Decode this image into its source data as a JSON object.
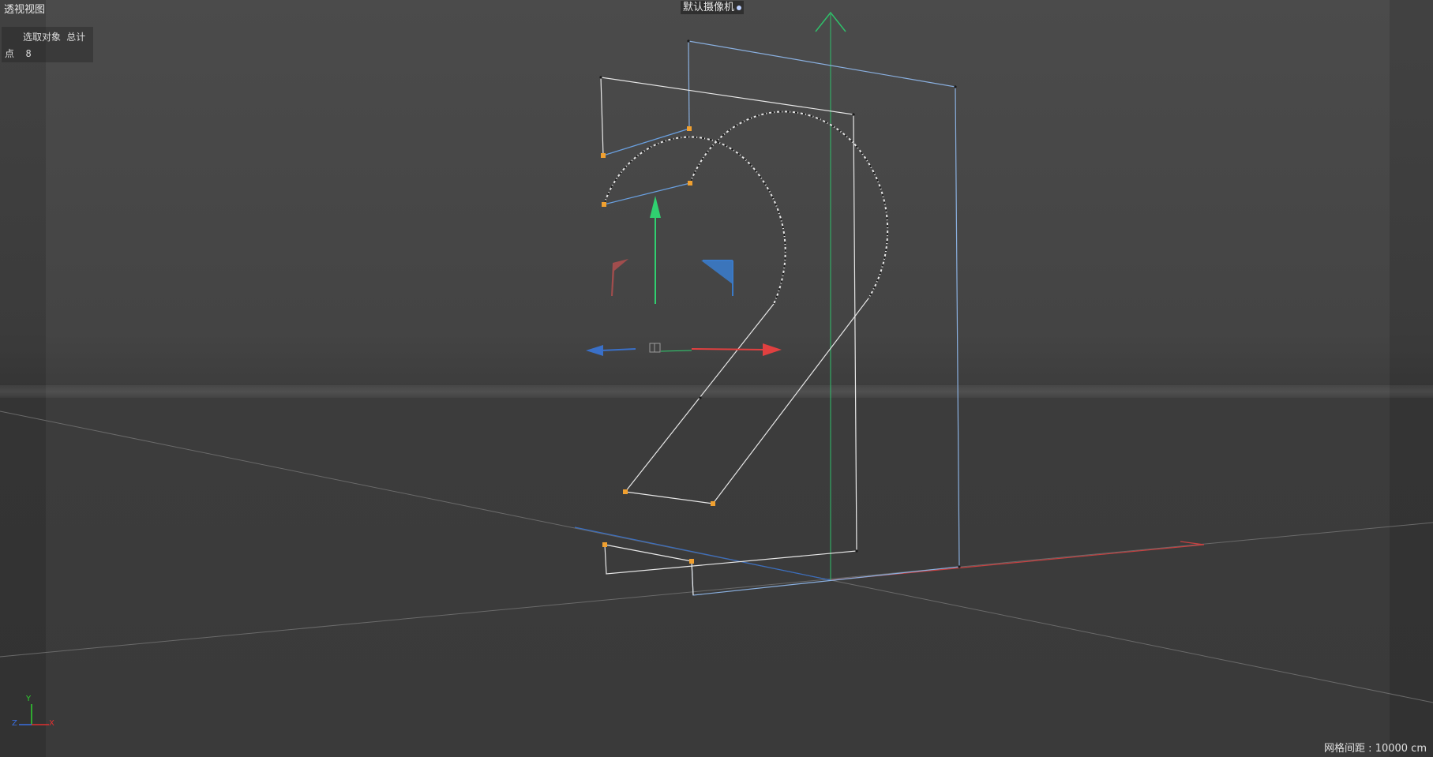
{
  "viewport": {
    "view_name": "透视视图",
    "camera_label": "默认摄像机",
    "camera_icon": "camera-icon"
  },
  "info_panel": {
    "header": "选取对象 总计",
    "rows": [
      {
        "label": "点",
        "value": "8"
      }
    ]
  },
  "status": {
    "grid_spacing": "网格间距 : 10000 cm"
  },
  "axis_indicator": {
    "x": "X",
    "y": "Y",
    "z": "Z"
  },
  "colors": {
    "selected_point": "#f0a030",
    "spline_white": "#e8e8e8",
    "spline_blue": "#8ab0e0",
    "axis_x": "#e04040",
    "axis_y": "#30d070",
    "axis_z": "#3a70c8"
  }
}
